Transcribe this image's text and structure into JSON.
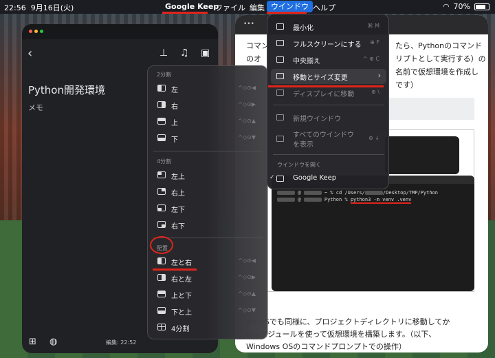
{
  "menubar": {
    "clock": "22:56",
    "date": "9月16日(火)",
    "app": "Google Keep",
    "menus": [
      "ファイル",
      "編集",
      "ウインドウ",
      "ヘルプ"
    ],
    "battery": "70%"
  },
  "keep": {
    "note_title": "Python開発環境",
    "note_body": "メモ",
    "edited": "編集: 22:52"
  },
  "submenu": {
    "section1": "2分割",
    "items1": [
      {
        "label": "左",
        "shortcut": "^◇⊙◀"
      },
      {
        "label": "右",
        "shortcut": "^◇⊙▶"
      },
      {
        "label": "上",
        "shortcut": "^◇⊙▲"
      },
      {
        "label": "下",
        "shortcut": "^◇⊙▼"
      }
    ],
    "section2": "4分割",
    "items2": [
      {
        "label": "左上"
      },
      {
        "label": "右上"
      },
      {
        "label": "左下"
      },
      {
        "label": "右下"
      }
    ],
    "section3": "配置",
    "items3": [
      {
        "label": "左と右",
        "shortcut": "^◇⊙◀"
      },
      {
        "label": "右と左",
        "shortcut": "^◇⊙▶"
      },
      {
        "label": "上と下",
        "shortcut": "^◇⊙▲"
      },
      {
        "label": "下と上",
        "shortcut": "^◇⊙▼"
      },
      {
        "label": "4分割"
      }
    ]
  },
  "windowmenu": {
    "items": [
      {
        "label": "最小化",
        "shortcut": "⌘ M"
      },
      {
        "label": "フルスクリーンにする",
        "shortcut": "⊕ F"
      },
      {
        "label": "中央揃え",
        "shortcut": "^ ⊕ C"
      },
      {
        "label": "移動とサイズ変更",
        "chevron": "›"
      },
      {
        "label": "ディスプレイに移動",
        "shortcut": "⊕ \\"
      },
      {
        "label": "新規ウインドウ"
      },
      {
        "label": "すべてのウインドウ",
        "label2": "を表示",
        "shortcut": "⊕ ↓"
      }
    ],
    "open_header": "ウインドウを開く",
    "open_item": "Google Keep",
    "check": "✓"
  },
  "doc": {
    "p1_line1": "コマン",
    "p1_line1b": "たら、Pythonのコマンド",
    "p1_line2": "のオ",
    "p1_line2b": "リプトとして実行する）の",
    "p1_line3b": "名前で仮想環境を作成し",
    "p1_line4b": "です）",
    "p2_line1": "ws OSでも同様に、プロジェクトディレクトリに移動してか",
    "p2_line2": "envモジュールを使って仮想環境を構築します。（以下、",
    "p2_line3": "Windows OSのコマンドプロンプトでの操作）"
  },
  "terminal": {
    "line1_prefix": "@",
    "line1_cmd": "~ % cd /Users/",
    "line1_path": "/Desktop/TMP/Python",
    "line2_prefix": "@",
    "line2_prompt": "Python %",
    "line2_cmd": "python3 -m venv .venv"
  }
}
